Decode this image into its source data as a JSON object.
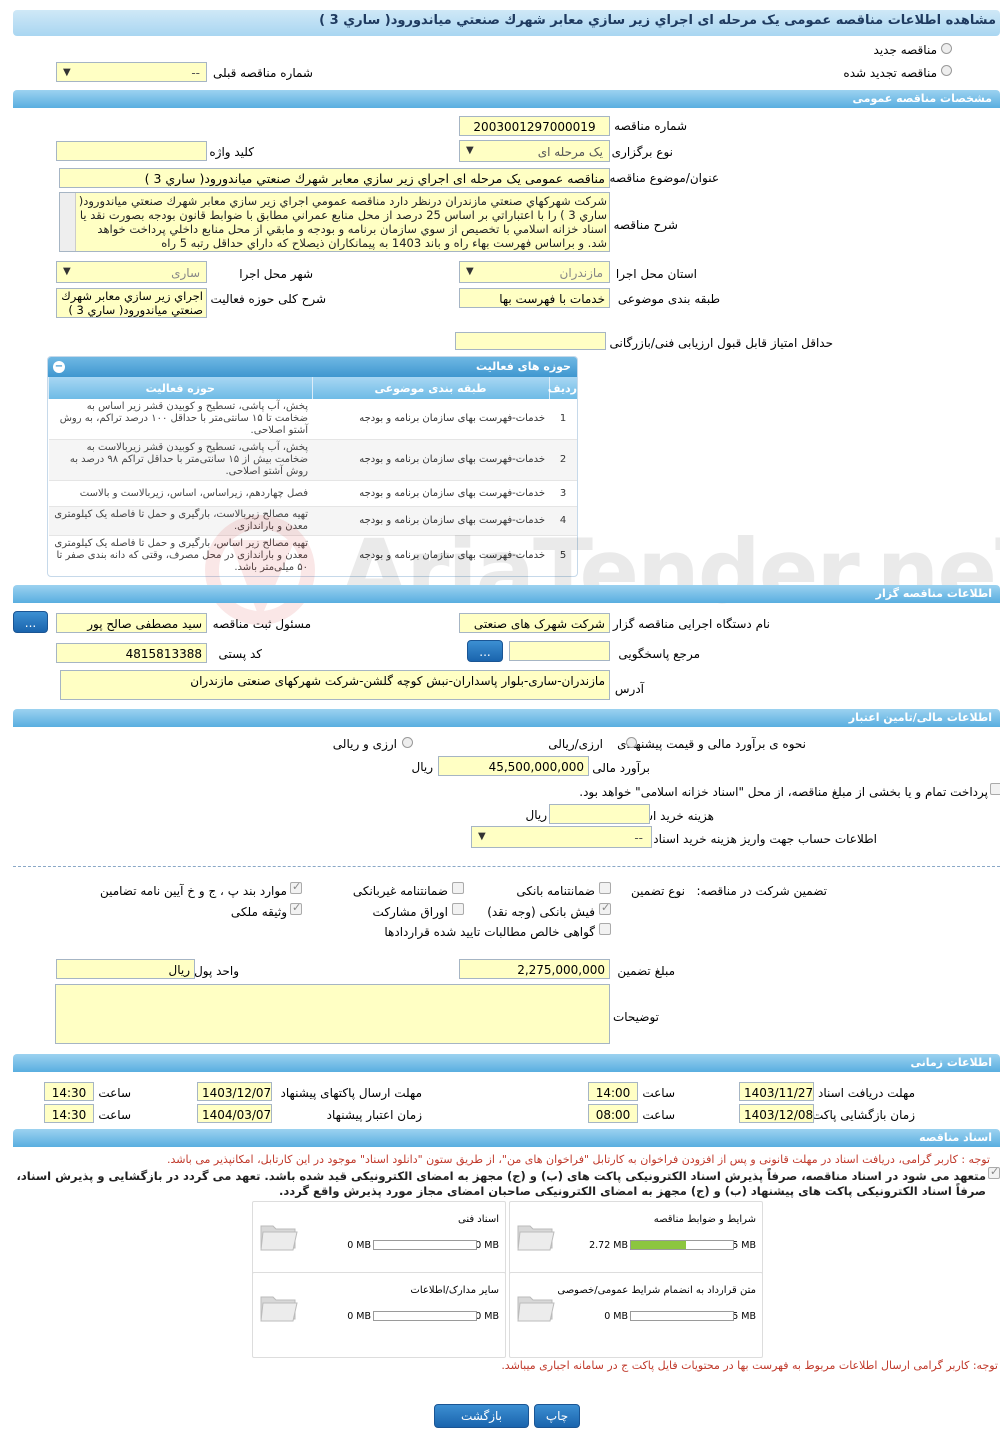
{
  "page": {
    "title": "مشاهده اطلاعات مناقصه عمومی یک مرحله ای اجراي زير سازي معابر شهرك صنعتي مياندورود( ساري 3 )"
  },
  "type_section": {
    "new_tender": "مناقصه جدید",
    "renewed_tender": "مناقصه تجدید شده",
    "prev_tender_label": "شماره مناقصه قبلی",
    "prev_tender_value": "--"
  },
  "general": {
    "header": "مشخصات مناقصه عمومی",
    "number_label": "شماره مناقصه",
    "number_value": "2003001297000019",
    "type_label": "نوع برگزاری",
    "type_value": "یک مرحله ای",
    "keyword_label": "کلید واژه",
    "keyword_value": "",
    "subject_label": "عنوان/موضوع مناقصه",
    "subject_value": "مناقصه عمومی یک مرحله ای اجراي زير سازي معابر شهرك صنعتي مياندورود( ساري 3 )",
    "desc_label": "شرح مناقصه",
    "desc_value": "شركت شهركهاي صنعتي مازندران درنظر دارد مناقصه عمومي اجراي زير سازي معابر شهرك صنعتي مياندورود( ساري 3 ) را با اعتباراتي بر اساس 25 درصد از محل منابع عمراني مطابق با ضوابط قانون بودجه بصورت نقد يا اسناد خزانه اسلامي با تخصيص از سوي سازمان برنامه و بودجه و مابقي از محل منابع داخلي پرداخت خواهد شد.  و براساس فهرست بهاء راه و باند 1403 به پيمانكاران ذيصلاح كه داراي حداقل رتبه 5 راه",
    "province_label": "استان محل اجرا",
    "province_value": "مازندران",
    "city_label": "شهر محل اجرا",
    "city_value": "ساری",
    "category_label": "طبقه بندی موضوعی",
    "category_value": "خدمات با فهرست بها",
    "scope_label": "شرح کلی حوزه فعالیت",
    "scope_value": "اجراي زير سازي معابر شهرك صنعتي مياندورود( ساري 3 )",
    "min_score_label": "حداقل امتیاز قابل قبول ارزیابی فنی/بازرگانی",
    "min_score_value": ""
  },
  "activity": {
    "header": "حوزه های فعالیت",
    "columns": [
      "ردیف",
      "طبقه بندی موضوعی",
      "حوزه فعالیت"
    ],
    "rows": [
      {
        "n": "1",
        "cat": "خدمات-فهرست بهای سازمان برنامه و بودجه",
        "act": "پخش، آب پاشی، تسطیح و کوبیدن قشر زیر اساس به ضخامت تا ۱۵ سانتی‌متر با حداقل ۱۰۰ درصد تراکم، به روش آشتو اصلاحی."
      },
      {
        "n": "2",
        "cat": "خدمات-فهرست بهای سازمان برنامه و بودجه",
        "act": "پخش، آب پاشی، تسطیح و کوبیدن قشر زیربالاست به ضخامت بیش از ۱۵ سانتی‌متر با حداقل تراکم ۹۸ درصد به روش آشتو اصلاحی."
      },
      {
        "n": "3",
        "cat": "خدمات-فهرست بهای سازمان برنامه و بودجه",
        "act": "فصل چهاردهم، زیراساس، اساس، زیربالاست  و بالاست"
      },
      {
        "n": "4",
        "cat": "خدمات-فهرست بهای سازمان برنامه و بودجه",
        "act": "تهیه مصالح زیربالاست، بارگیری و حمل تا فاصله یک کیلومتری معدن و باراندازی."
      },
      {
        "n": "5",
        "cat": "خدمات-فهرست بهای سازمان برنامه و بودجه",
        "act": "تهیه مصالح زیر اساس، بارگیری و حمل تا فاصله یک کیلومتری معدن و باراندازی در محل مصرف، وقتی که دانه بندی صفر تا ۵۰ میلی‌متر باشد."
      }
    ]
  },
  "organizer": {
    "header": "اطلاعات مناقصه گزار",
    "org_label": "نام دستگاه اجرایی مناقصه گزار",
    "org_value": "شرکت شهرک های صنعتی",
    "registrar_label": "مسئول ثبت مناقصه",
    "registrar_value": "سید مصطفی صالح پور",
    "ref_label": "مرجع پاسخگویی",
    "ref_value": "",
    "postal_label": "کد پستی",
    "postal_value": "4815813388",
    "address_label": "آدرس",
    "address_value": "مازندران-ساری-بلوار پاسداران-نبش کوچه گلشن-شرکت شهرکهای صنعتی مازندران",
    "browse": "..."
  },
  "finance": {
    "header": "اطلاعات مالی/تامین اعتبار",
    "method_label": "نحوه ی برآورد مالی و قیمت پیشنهادی",
    "opt1": "ارزی/ریالی",
    "opt2": "ارزی و ریالی",
    "estimate_label": "برآورد مالی",
    "estimate_value": "45,500,000,000",
    "rial": "ریال",
    "treasury": "پرداخت تمام و یا بخشی از مبلغ مناقصه، از محل \"اسناد خزانه اسلامی\" خواهد بود.",
    "doc_cost_label": "هزینه خرید اسناد",
    "doc_cost_value": "",
    "doc_cost_unit": "ریال",
    "account_label": "اطلاعات حساب جهت واریز هزینه خرید اسناد",
    "account_value": "--"
  },
  "guarantee": {
    "participation_label": "تضمین شرکت در مناقصه:",
    "type_label": "نوع تضمین",
    "items": {
      "bank": "ضمانتنامه بانکی",
      "nonbank": "ضمانتنامه غیربانکی",
      "article": "موارد بند پ ، ج و خ آیین نامه تضامین",
      "cash": "فیش بانکی (وجه نقد)",
      "bonds": "اوراق مشارکت",
      "property": "وثیقه ملکی",
      "receivable": "گواهی خالص مطالبات تایید شده قراردادها"
    },
    "amount_label": "مبلغ تضمین",
    "amount_value": "2,275,000,000",
    "currency_label": "واحد پول",
    "currency_value": "ریال",
    "notes_label": "توضیحات",
    "notes_value": ""
  },
  "timing": {
    "header": "اطلاعات زمانی",
    "doc_receive_label": "مهلت دریافت اسناد",
    "doc_receive_date": "1403/11/27",
    "doc_receive_time": "14:00",
    "send_label": "مهلت ارسال پاکتهای پیشنهاد",
    "send_date": "1403/12/07",
    "send_time": "14:30",
    "open_label": "زمان بازگشایی پاکت ها",
    "open_date": "1403/12/08",
    "open_time": "08:00",
    "valid_label": "زمان اعتبار پیشنهاد",
    "valid_date": "1404/03/07",
    "valid_time": "14:30",
    "time_label": "ساعت"
  },
  "docs": {
    "header": "اسناد مناقصه",
    "notice": "توجه : کاربر گرامی، دریافت اسناد در مهلت قانونی و پس از افزودن فراخوان به کارتابل \"فراخوان های من\"، از طریق ستون \"دانلود اسناد\" موجود در این کارتابل، امکانپذیر می باشد.",
    "commit1": "متعهد می شود در اسناد مناقصه، صرفاً پذیرش اسناد الکترونیکی پاکت های (ب) و (ج) مجهز به امضای الکترونیکی قید شده باشد. تعهد می گردد در بازگشایی و پذیرش اسناد،",
    "commit2": "صرفاً اسناد الکترونیکی پاکت های پیشنهاد (ب) و (ج) مجهز به امضای الکترونیکی صاحبان امضای مجاز مورد پذیرش واقع گردد.",
    "files": [
      {
        "title": "شرایط و ضوابط مناقصه",
        "size": "2.72 MB",
        "max": "5 MB",
        "fill": 0.544
      },
      {
        "title": "اسناد فنی",
        "size": "0 MB",
        "max": "50 MB",
        "fill": 0
      },
      {
        "title": "متن قرارداد به انضمام شرایط عمومی/خصوصی",
        "size": "0 MB",
        "max": "5 MB",
        "fill": 0
      },
      {
        "title": "سایر مدارک/اطلاعات",
        "size": "0 MB",
        "max": "50 MB",
        "fill": 0
      }
    ],
    "footer_note": "توجه: کاربر گرامی ارسال اطلاعات مربوط به فهرست بها در محتویات فایل پاکت ج در سامانه اجباری میباشد."
  },
  "actions": {
    "print": "چاپ",
    "back": "بازگشت"
  },
  "watermark": "AriaTender.neT"
}
